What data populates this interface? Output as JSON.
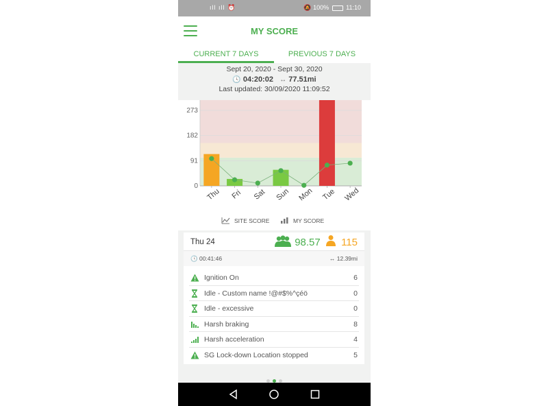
{
  "status_bar": {
    "signal": "ıll ıll ⏰",
    "battery": "100%",
    "time": "11:10"
  },
  "app": {
    "title": "MY SCORE"
  },
  "tabs": [
    {
      "label": "CURRENT 7 DAYS"
    },
    {
      "label": "PREVIOUS 7 DAYS"
    }
  ],
  "summary": {
    "date_range": "Sept 20, 2020 - Sept 30, 2020",
    "duration": "04:20:02",
    "distance": "77.51mi",
    "last_updated": "Last updated: 30/09/2020 11:09:52"
  },
  "chart_data": {
    "type": "bar",
    "categories": [
      "Thu",
      "Fri",
      "Sat",
      "Sun",
      "Mon",
      "Tue",
      "Wed"
    ],
    "series": [
      {
        "name": "MY SCORE",
        "kind": "bar",
        "values": [
          115,
          25,
          0,
          58,
          0,
          310,
          0
        ],
        "colors": [
          "#f5a623",
          "#7ac943",
          "#7ac943",
          "#7ac943",
          "#7ac943",
          "#dc3c3c",
          "#7ac943"
        ]
      },
      {
        "name": "SITE SCORE",
        "kind": "line",
        "values": [
          98.57,
          22,
          10,
          55,
          2,
          75,
          82
        ]
      }
    ],
    "yticks": [
      0,
      91,
      182,
      273
    ],
    "ylim": [
      0,
      310
    ],
    "bands": [
      {
        "from": 0,
        "to": 102,
        "color": "#d9ecd6"
      },
      {
        "from": 102,
        "to": 155,
        "color": "#f7e8d4"
      },
      {
        "from": 155,
        "to": 310,
        "color": "#f1dcda"
      }
    ]
  },
  "legend": {
    "site_score": "SITE SCORE",
    "my_score": "MY SCORE"
  },
  "day_detail": {
    "day": "Thu 24",
    "site_score": "98.57",
    "my_score": "115",
    "duration": "00:41:46",
    "distance": "12.39mi",
    "events": [
      {
        "icon": "warning-icon",
        "label": "Ignition On",
        "count": "6"
      },
      {
        "icon": "hourglass-icon",
        "label": "Idle - Custom name !@#$%^çéö",
        "count": "0"
      },
      {
        "icon": "hourglass-icon",
        "label": "Idle - excessive",
        "count": "0"
      },
      {
        "icon": "harsh-braking-icon",
        "label": "Harsh braking",
        "count": "8"
      },
      {
        "icon": "harsh-acceleration-icon",
        "label": "Harsh acceleration",
        "count": "4"
      },
      {
        "icon": "warning-icon",
        "label": "SG Lock-down Location stopped",
        "count": "5"
      }
    ]
  },
  "colors": {
    "accent": "#4caf50",
    "my_score": "#f5a623",
    "alert_bar": "#dc3c3c"
  }
}
